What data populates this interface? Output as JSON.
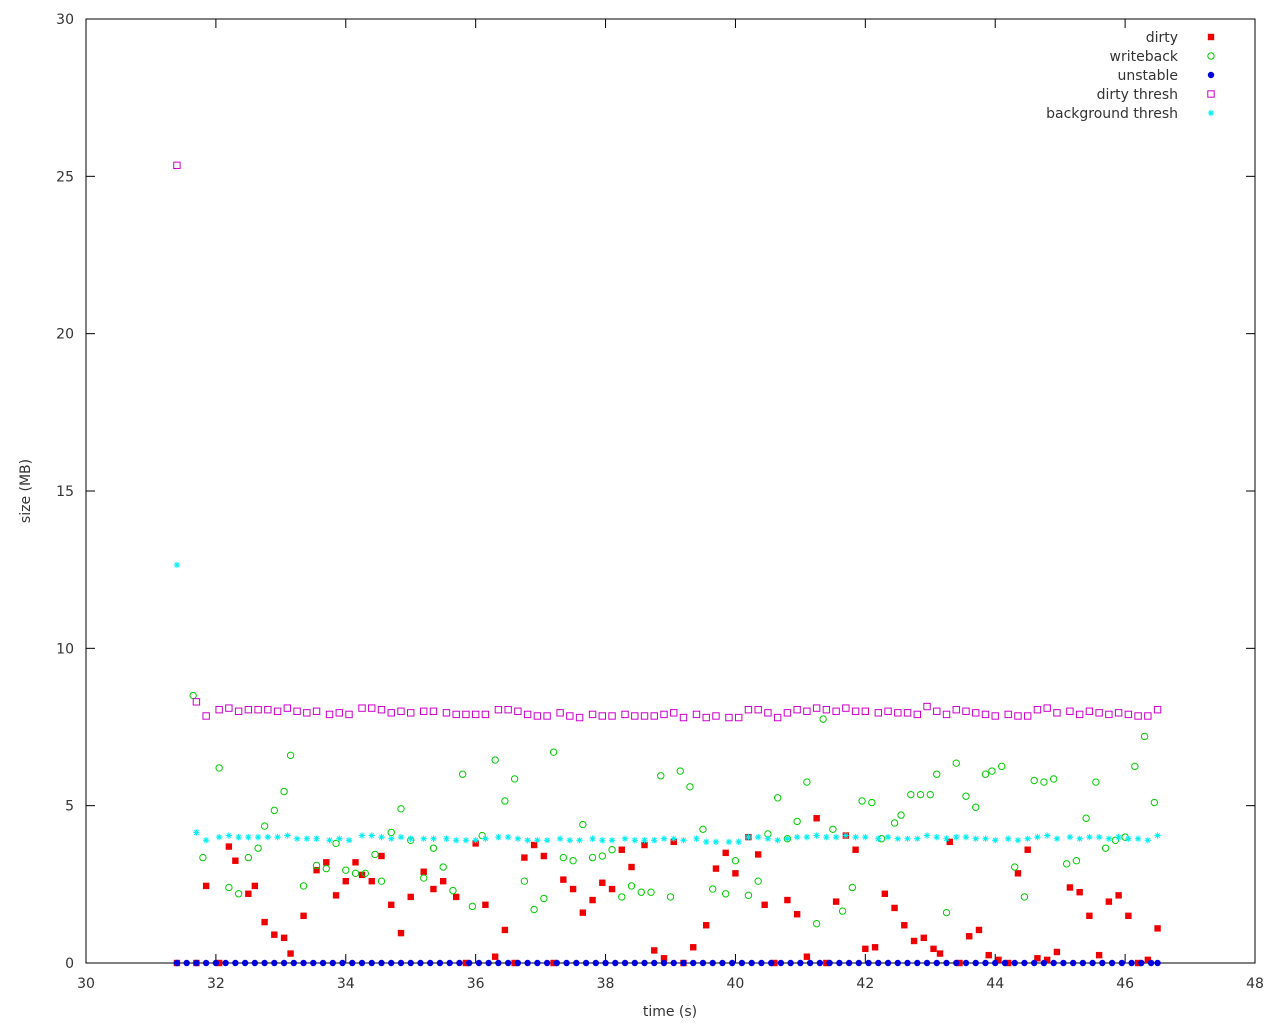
{
  "chart_data": {
    "type": "scatter",
    "xlabel": "time (s)",
    "ylabel": "size (MB)",
    "xlim": [
      30,
      48
    ],
    "ylim": [
      0,
      30
    ],
    "xticks": [
      30,
      32,
      34,
      36,
      38,
      40,
      42,
      44,
      46,
      48
    ],
    "yticks": [
      0,
      5,
      10,
      15,
      20,
      25,
      30
    ],
    "grid": false,
    "legend": "top-right",
    "series": [
      {
        "name": "dirty",
        "color": "#ee0000",
        "marker": "filled-square",
        "x": [
          31.4,
          31.7,
          31.85,
          32.05,
          32.2,
          32.3,
          32.5,
          32.6,
          32.75,
          32.9,
          33.05,
          33.15,
          33.35,
          33.55,
          33.7,
          33.85,
          34.0,
          34.15,
          34.25,
          34.4,
          34.55,
          34.7,
          34.85,
          35.0,
          35.2,
          35.35,
          35.5,
          35.7,
          35.85,
          36.0,
          36.15,
          36.3,
          36.45,
          36.6,
          36.75,
          36.9,
          37.05,
          37.2,
          37.35,
          37.5,
          37.65,
          37.8,
          37.95,
          38.1,
          38.25,
          38.4,
          38.6,
          38.75,
          38.9,
          39.05,
          39.2,
          39.35,
          39.55,
          39.7,
          39.85,
          40.0,
          40.2,
          40.35,
          40.45,
          40.6,
          40.8,
          40.95,
          41.1,
          41.25,
          41.4,
          41.55,
          41.7,
          41.85,
          42.0,
          42.15,
          42.3,
          42.45,
          42.6,
          42.75,
          42.9,
          43.05,
          43.15,
          43.3,
          43.45,
          43.6,
          43.75,
          43.9,
          44.05,
          44.2,
          44.35,
          44.5,
          44.65,
          44.8,
          44.95,
          45.15,
          45.3,
          45.45,
          45.6,
          45.75,
          45.9,
          46.05,
          46.2,
          46.35,
          46.5
        ],
        "y": [
          0,
          0,
          2.45,
          0,
          3.7,
          3.25,
          2.2,
          2.45,
          1.3,
          0.9,
          0.8,
          0.3,
          1.5,
          2.95,
          3.2,
          2.15,
          2.6,
          3.2,
          2.8,
          2.6,
          3.4,
          1.85,
          0.95,
          2.1,
          2.9,
          2.35,
          2.6,
          2.1,
          0,
          3.8,
          1.85,
          0.2,
          1.05,
          0,
          3.35,
          3.75,
          3.4,
          0,
          2.65,
          2.35,
          1.6,
          2.0,
          2.55,
          2.35,
          3.6,
          3.05,
          3.75,
          0.4,
          0.15,
          3.85,
          0,
          0.5,
          1.2,
          3.0,
          3.5,
          2.85,
          4.0,
          3.45,
          1.85,
          0,
          2.0,
          1.55,
          0.2,
          4.6,
          0,
          1.95,
          4.05,
          3.6,
          0.45,
          0.5,
          2.2,
          1.75,
          1.2,
          0.7,
          0.8,
          0.45,
          0.3,
          3.85,
          0,
          0.85,
          1.05,
          0.25,
          0.1,
          0,
          2.85,
          3.6,
          0.15,
          0.1,
          0.35,
          2.4,
          2.25,
          1.5,
          0.25,
          1.95,
          2.15,
          1.5,
          0,
          0.1,
          1.1
        ]
      },
      {
        "name": "writeback",
        "color": "#00cc00",
        "marker": "open-circle",
        "x": [
          31.65,
          31.8,
          32.05,
          32.2,
          32.35,
          32.5,
          32.65,
          32.75,
          32.9,
          33.05,
          33.15,
          33.35,
          33.55,
          33.7,
          33.85,
          34.0,
          34.15,
          34.3,
          34.45,
          34.55,
          34.7,
          34.85,
          35.0,
          35.2,
          35.35,
          35.5,
          35.65,
          35.8,
          35.95,
          36.1,
          36.3,
          36.45,
          36.6,
          36.75,
          36.9,
          37.05,
          37.2,
          37.35,
          37.5,
          37.65,
          37.8,
          37.95,
          38.1,
          38.25,
          38.4,
          38.55,
          38.7,
          38.85,
          39.0,
          39.15,
          39.3,
          39.5,
          39.65,
          39.85,
          40.0,
          40.2,
          40.35,
          40.5,
          40.65,
          40.8,
          40.95,
          41.1,
          41.25,
          41.35,
          41.5,
          41.65,
          41.8,
          41.95,
          42.1,
          42.25,
          42.45,
          42.55,
          42.7,
          42.85,
          43.0,
          43.1,
          43.25,
          43.4,
          43.55,
          43.7,
          43.85,
          43.95,
          44.1,
          44.3,
          44.45,
          44.6,
          44.75,
          44.9,
          45.1,
          45.25,
          45.4,
          45.55,
          45.7,
          45.85,
          46.0,
          46.15,
          46.3,
          46.45
        ],
        "y": [
          8.5,
          3.35,
          6.2,
          2.4,
          2.2,
          3.35,
          3.65,
          4.35,
          4.85,
          5.45,
          6.6,
          2.45,
          3.1,
          3.0,
          3.8,
          2.95,
          2.85,
          2.85,
          3.45,
          2.6,
          4.15,
          4.9,
          3.9,
          2.7,
          3.65,
          3.05,
          2.3,
          6.0,
          1.8,
          4.05,
          6.45,
          5.15,
          5.85,
          2.6,
          1.7,
          2.05,
          6.7,
          3.35,
          3.25,
          4.4,
          3.35,
          3.4,
          3.6,
          2.1,
          2.45,
          2.25,
          2.25,
          5.95,
          2.1,
          6.1,
          5.6,
          4.25,
          2.35,
          2.2,
          3.25,
          2.15,
          2.6,
          4.1,
          5.25,
          3.95,
          4.5,
          5.75,
          1.25,
          7.75,
          4.25,
          1.65,
          2.4,
          5.15,
          5.1,
          3.95,
          4.45,
          4.7,
          5.35,
          5.35,
          5.35,
          6.0,
          1.6,
          6.35,
          5.3,
          4.95,
          6.0,
          6.1,
          6.25,
          3.05,
          2.1,
          5.8,
          5.75,
          5.85,
          3.15,
          3.25,
          4.6,
          5.75,
          3.65,
          3.9,
          4.0,
          6.25,
          7.2,
          5.1
        ]
      },
      {
        "name": "unstable",
        "color": "#0000dd",
        "marker": "filled-circle",
        "x": [
          31.4,
          31.55,
          31.7,
          31.85,
          32.0,
          32.15,
          32.3,
          32.45,
          32.6,
          32.75,
          32.9,
          33.05,
          33.2,
          33.35,
          33.5,
          33.65,
          33.8,
          33.95,
          34.1,
          34.25,
          34.4,
          34.55,
          34.7,
          34.85,
          35.0,
          35.15,
          35.3,
          35.45,
          35.6,
          35.75,
          35.9,
          36.05,
          36.2,
          36.35,
          36.5,
          36.65,
          36.8,
          36.95,
          37.1,
          37.25,
          37.4,
          37.55,
          37.7,
          37.85,
          38.0,
          38.15,
          38.3,
          38.45,
          38.6,
          38.75,
          38.9,
          39.05,
          39.2,
          39.35,
          39.5,
          39.65,
          39.8,
          39.95,
          40.1,
          40.25,
          40.4,
          40.55,
          40.7,
          40.85,
          41.0,
          41.15,
          41.3,
          41.45,
          41.6,
          41.75,
          41.9,
          42.05,
          42.2,
          42.35,
          42.5,
          42.65,
          42.8,
          42.95,
          43.1,
          43.25,
          43.4,
          43.55,
          43.7,
          43.85,
          44.0,
          44.15,
          44.3,
          44.45,
          44.6,
          44.75,
          44.9,
          45.05,
          45.2,
          45.35,
          45.5,
          45.65,
          45.8,
          45.95,
          46.1,
          46.25,
          46.4,
          46.5
        ],
        "y": [
          0,
          0,
          0,
          0,
          0,
          0,
          0,
          0,
          0,
          0,
          0,
          0,
          0,
          0,
          0,
          0,
          0,
          0,
          0,
          0,
          0,
          0,
          0,
          0,
          0,
          0,
          0,
          0,
          0,
          0,
          0,
          0,
          0,
          0,
          0,
          0,
          0,
          0,
          0,
          0,
          0,
          0,
          0,
          0,
          0,
          0,
          0,
          0,
          0,
          0,
          0,
          0,
          0,
          0,
          0,
          0,
          0,
          0,
          0,
          0,
          0,
          0,
          0,
          0,
          0,
          0,
          0,
          0,
          0,
          0,
          0,
          0,
          0,
          0,
          0,
          0,
          0,
          0,
          0,
          0,
          0,
          0,
          0,
          0,
          0,
          0,
          0,
          0,
          0,
          0,
          0,
          0,
          0,
          0,
          0,
          0,
          0,
          0,
          0,
          0,
          0,
          0
        ]
      },
      {
        "name": "dirty thresh",
        "color": "#cc00cc",
        "marker": "open-square",
        "x": [
          31.4,
          31.7,
          31.85,
          32.05,
          32.2,
          32.35,
          32.5,
          32.65,
          32.8,
          32.95,
          33.1,
          33.25,
          33.4,
          33.55,
          33.75,
          33.9,
          34.05,
          34.25,
          34.4,
          34.55,
          34.7,
          34.85,
          35.0,
          35.2,
          35.35,
          35.55,
          35.7,
          35.85,
          36.0,
          36.15,
          36.35,
          36.5,
          36.65,
          36.8,
          36.95,
          37.1,
          37.3,
          37.45,
          37.6,
          37.8,
          37.95,
          38.1,
          38.3,
          38.45,
          38.6,
          38.75,
          38.9,
          39.05,
          39.2,
          39.4,
          39.55,
          39.7,
          39.9,
          40.05,
          40.2,
          40.35,
          40.5,
          40.65,
          40.8,
          40.95,
          41.1,
          41.25,
          41.4,
          41.55,
          41.7,
          41.85,
          42.0,
          42.2,
          42.35,
          42.5,
          42.65,
          42.8,
          42.95,
          43.1,
          43.25,
          43.4,
          43.55,
          43.7,
          43.85,
          44.0,
          44.2,
          44.35,
          44.5,
          44.65,
          44.8,
          44.95,
          45.15,
          45.3,
          45.45,
          45.6,
          45.75,
          45.9,
          46.05,
          46.2,
          46.35,
          46.5
        ],
        "y": [
          25.35,
          8.3,
          7.85,
          8.05,
          8.1,
          8.0,
          8.05,
          8.05,
          8.05,
          8.0,
          8.1,
          8.0,
          7.95,
          8.0,
          7.9,
          7.95,
          7.9,
          8.1,
          8.1,
          8.05,
          7.95,
          8.0,
          7.95,
          8.0,
          8.0,
          7.95,
          7.9,
          7.9,
          7.9,
          7.9,
          8.05,
          8.05,
          8.0,
          7.9,
          7.85,
          7.85,
          7.95,
          7.85,
          7.8,
          7.9,
          7.85,
          7.85,
          7.9,
          7.85,
          7.85,
          7.85,
          7.9,
          7.95,
          7.8,
          7.9,
          7.8,
          7.85,
          7.8,
          7.8,
          8.05,
          8.05,
          7.95,
          7.8,
          7.95,
          8.05,
          8.0,
          8.1,
          8.05,
          8.0,
          8.1,
          8.0,
          8.0,
          7.95,
          8.0,
          7.95,
          7.95,
          7.9,
          8.15,
          8.0,
          7.9,
          8.05,
          8.0,
          7.95,
          7.9,
          7.85,
          7.9,
          7.85,
          7.85,
          8.05,
          8.1,
          7.95,
          8.0,
          7.9,
          8.0,
          7.95,
          7.9,
          7.95,
          7.9,
          7.85,
          7.85,
          8.05
        ]
      },
      {
        "name": "background thresh",
        "color": "#00eeee",
        "marker": "star",
        "x": [
          31.4,
          31.7,
          31.85,
          32.05,
          32.2,
          32.35,
          32.5,
          32.65,
          32.8,
          32.95,
          33.1,
          33.25,
          33.4,
          33.55,
          33.75,
          33.9,
          34.05,
          34.25,
          34.4,
          34.55,
          34.7,
          34.85,
          35.0,
          35.2,
          35.35,
          35.55,
          35.7,
          35.85,
          36.0,
          36.15,
          36.35,
          36.5,
          36.65,
          36.8,
          36.95,
          37.1,
          37.3,
          37.45,
          37.6,
          37.8,
          37.95,
          38.1,
          38.3,
          38.45,
          38.6,
          38.75,
          38.9,
          39.05,
          39.2,
          39.4,
          39.55,
          39.7,
          39.9,
          40.05,
          40.2,
          40.35,
          40.5,
          40.65,
          40.8,
          40.95,
          41.1,
          41.25,
          41.4,
          41.55,
          41.7,
          41.85,
          42.0,
          42.2,
          42.35,
          42.5,
          42.65,
          42.8,
          42.95,
          43.1,
          43.25,
          43.4,
          43.55,
          43.7,
          43.85,
          44.0,
          44.2,
          44.35,
          44.5,
          44.65,
          44.8,
          44.95,
          45.15,
          45.3,
          45.45,
          45.6,
          45.75,
          45.9,
          46.05,
          46.2,
          46.35,
          46.5
        ],
        "y": [
          12.65,
          4.15,
          3.9,
          4.0,
          4.05,
          4.0,
          4.0,
          4.0,
          4.0,
          4.0,
          4.05,
          3.95,
          3.95,
          3.95,
          3.9,
          3.95,
          3.9,
          4.05,
          4.05,
          4.0,
          3.95,
          4.0,
          3.95,
          3.95,
          3.95,
          3.95,
          3.9,
          3.9,
          3.9,
          3.95,
          4.0,
          4.0,
          3.95,
          3.9,
          3.9,
          3.9,
          3.95,
          3.9,
          3.9,
          3.95,
          3.9,
          3.9,
          3.95,
          3.9,
          3.9,
          3.9,
          3.95,
          3.95,
          3.9,
          3.95,
          3.85,
          3.85,
          3.85,
          3.85,
          4.0,
          4.0,
          3.95,
          3.9,
          3.95,
          4.0,
          4.0,
          4.05,
          4.0,
          4.0,
          4.05,
          4.0,
          4.0,
          3.95,
          4.0,
          3.95,
          3.95,
          3.95,
          4.05,
          4.0,
          3.95,
          4.0,
          4.0,
          3.95,
          3.95,
          3.9,
          3.95,
          3.9,
          3.95,
          4.0,
          4.05,
          3.95,
          4.0,
          3.95,
          4.0,
          4.0,
          3.95,
          4.0,
          3.95,
          3.95,
          3.9,
          4.05
        ]
      }
    ]
  }
}
